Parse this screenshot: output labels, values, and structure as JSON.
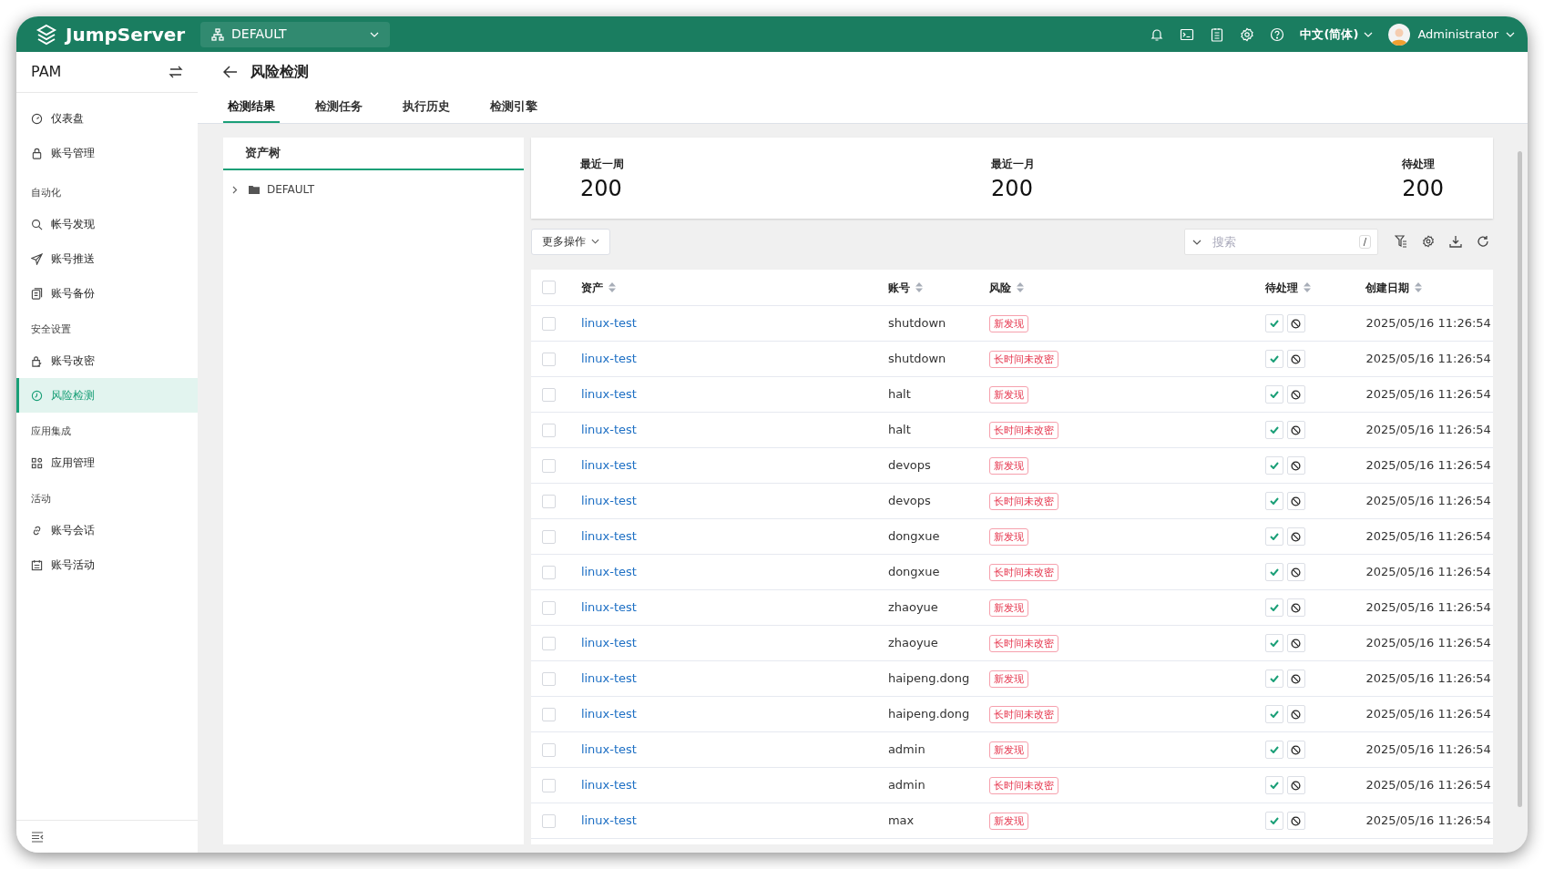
{
  "topbar": {
    "logo": "JumpServer",
    "org": "DEFAULT",
    "language": "中文(简体)",
    "user": "Administrator"
  },
  "sidebar": {
    "title": "PAM",
    "sections": [
      {
        "items": [
          {
            "label": "仪表盘",
            "selected": false
          },
          {
            "label": "账号管理",
            "selected": false
          }
        ]
      },
      {
        "title": "自动化",
        "items": [
          {
            "label": "帐号发现",
            "selected": false
          },
          {
            "label": "账号推送",
            "selected": false
          },
          {
            "label": "账号备份",
            "selected": false
          }
        ]
      },
      {
        "title": "安全设置",
        "items": [
          {
            "label": "账号改密",
            "selected": false
          },
          {
            "label": "风险检测",
            "selected": true
          }
        ]
      },
      {
        "title": "应用集成",
        "items": [
          {
            "label": "应用管理",
            "selected": false
          }
        ]
      },
      {
        "title": "活动",
        "items": [
          {
            "label": "账号会话",
            "selected": false
          },
          {
            "label": "账号活动",
            "selected": false
          }
        ]
      }
    ]
  },
  "page": {
    "title": "风险检测",
    "tabs": [
      {
        "label": "检测结果",
        "selected": true
      },
      {
        "label": "检测任务",
        "selected": false
      },
      {
        "label": "执行历史",
        "selected": false
      },
      {
        "label": "检测引擎",
        "selected": false
      }
    ]
  },
  "tree": {
    "title": "资产树",
    "nodes": [
      {
        "label": "DEFAULT",
        "expanded": false
      }
    ]
  },
  "stats": [
    {
      "label": "最近一周",
      "value": "200"
    },
    {
      "label": "最近一月",
      "value": "200"
    },
    {
      "label": "待处理",
      "value": "200"
    }
  ],
  "toolbar": {
    "more_actions": "更多操作",
    "search_placeholder": "搜索",
    "shortcut": "/"
  },
  "table": {
    "select_all_checked": false,
    "columns": [
      "资产",
      "账号",
      "风险",
      "待处理",
      "创建日期"
    ],
    "rows": [
      {
        "asset": "linux-test",
        "account": "shutdown",
        "risk": "新发现",
        "date": "2025/05/16 11:26:54",
        "checked": false
      },
      {
        "asset": "linux-test",
        "account": "shutdown",
        "risk": "长时间未改密",
        "date": "2025/05/16 11:26:54",
        "checked": false
      },
      {
        "asset": "linux-test",
        "account": "halt",
        "risk": "新发现",
        "date": "2025/05/16 11:26:54",
        "checked": false
      },
      {
        "asset": "linux-test",
        "account": "halt",
        "risk": "长时间未改密",
        "date": "2025/05/16 11:26:54",
        "checked": false
      },
      {
        "asset": "linux-test",
        "account": "devops",
        "risk": "新发现",
        "date": "2025/05/16 11:26:54",
        "checked": false
      },
      {
        "asset": "linux-test",
        "account": "devops",
        "risk": "长时间未改密",
        "date": "2025/05/16 11:26:54",
        "checked": false
      },
      {
        "asset": "linux-test",
        "account": "dongxue",
        "risk": "新发现",
        "date": "2025/05/16 11:26:54",
        "checked": false
      },
      {
        "asset": "linux-test",
        "account": "dongxue",
        "risk": "长时间未改密",
        "date": "2025/05/16 11:26:54",
        "checked": false
      },
      {
        "asset": "linux-test",
        "account": "zhaoyue",
        "risk": "新发现",
        "date": "2025/05/16 11:26:54",
        "checked": false
      },
      {
        "asset": "linux-test",
        "account": "zhaoyue",
        "risk": "长时间未改密",
        "date": "2025/05/16 11:26:54",
        "checked": false
      },
      {
        "asset": "linux-test",
        "account": "haipeng.dong",
        "risk": "新发现",
        "date": "2025/05/16 11:26:54",
        "checked": false
      },
      {
        "asset": "linux-test",
        "account": "haipeng.dong",
        "risk": "长时间未改密",
        "date": "2025/05/16 11:26:54",
        "checked": false
      },
      {
        "asset": "linux-test",
        "account": "admin",
        "risk": "新发现",
        "date": "2025/05/16 11:26:54",
        "checked": false
      },
      {
        "asset": "linux-test",
        "account": "admin",
        "risk": "长时间未改密",
        "date": "2025/05/16 11:26:54",
        "checked": false
      },
      {
        "asset": "linux-test",
        "account": "max",
        "risk": "新发现",
        "date": "2025/05/16 11:26:54",
        "checked": false
      }
    ]
  }
}
